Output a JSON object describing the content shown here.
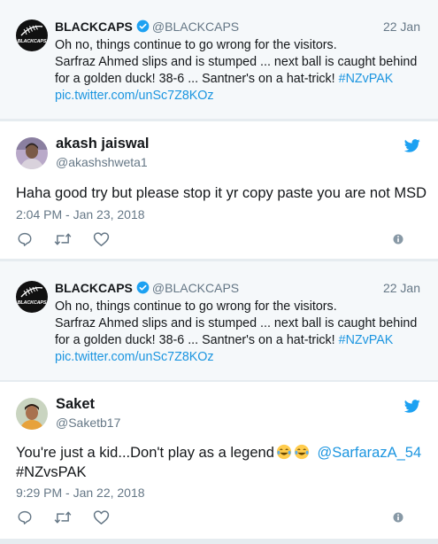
{
  "quoted_tweet": {
    "name": "BLACKCAPS",
    "handle": "@BLACKCAPS",
    "date": "22 Jan",
    "avatar_label": "BLACKCAPS",
    "lines": [
      "Oh no, things continue to go wrong for the visitors.",
      "Sarfraz Ahmed slips and is stumped ... next ball is caught behind",
      "for a golden duck! 38-6 ... Santner's on a hat-trick!"
    ],
    "hashtag": "#NZvPAK",
    "link": "pic.twitter.com/unSc7Z8KOz"
  },
  "replies": [
    {
      "name": "akash jaiswal",
      "handle": "@akashshweta1",
      "text": "Haha good try but please stop it yr copy paste you are not MSD",
      "timestamp": "2:04 PM - Jan 23, 2018"
    },
    {
      "name": "Saket",
      "handle": "@Saketb17",
      "text": "You're just a kid...Don't play as a legend",
      "mention": "@SarfarazA_54",
      "hashtag": "#NZvsPAK",
      "timestamp": "9:29 PM - Jan 22, 2018"
    }
  ],
  "icons": {
    "reply": "reply-icon",
    "retweet": "retweet-icon",
    "like": "heart-icon",
    "info": "info-icon",
    "twitter": "twitter-bird-icon",
    "verified": "verified-badge-icon"
  },
  "colors": {
    "link": "#1b95e0",
    "twitter_blue": "#1da1f2",
    "muted": "#657786",
    "quoted_bg": "#f5f8fa"
  }
}
